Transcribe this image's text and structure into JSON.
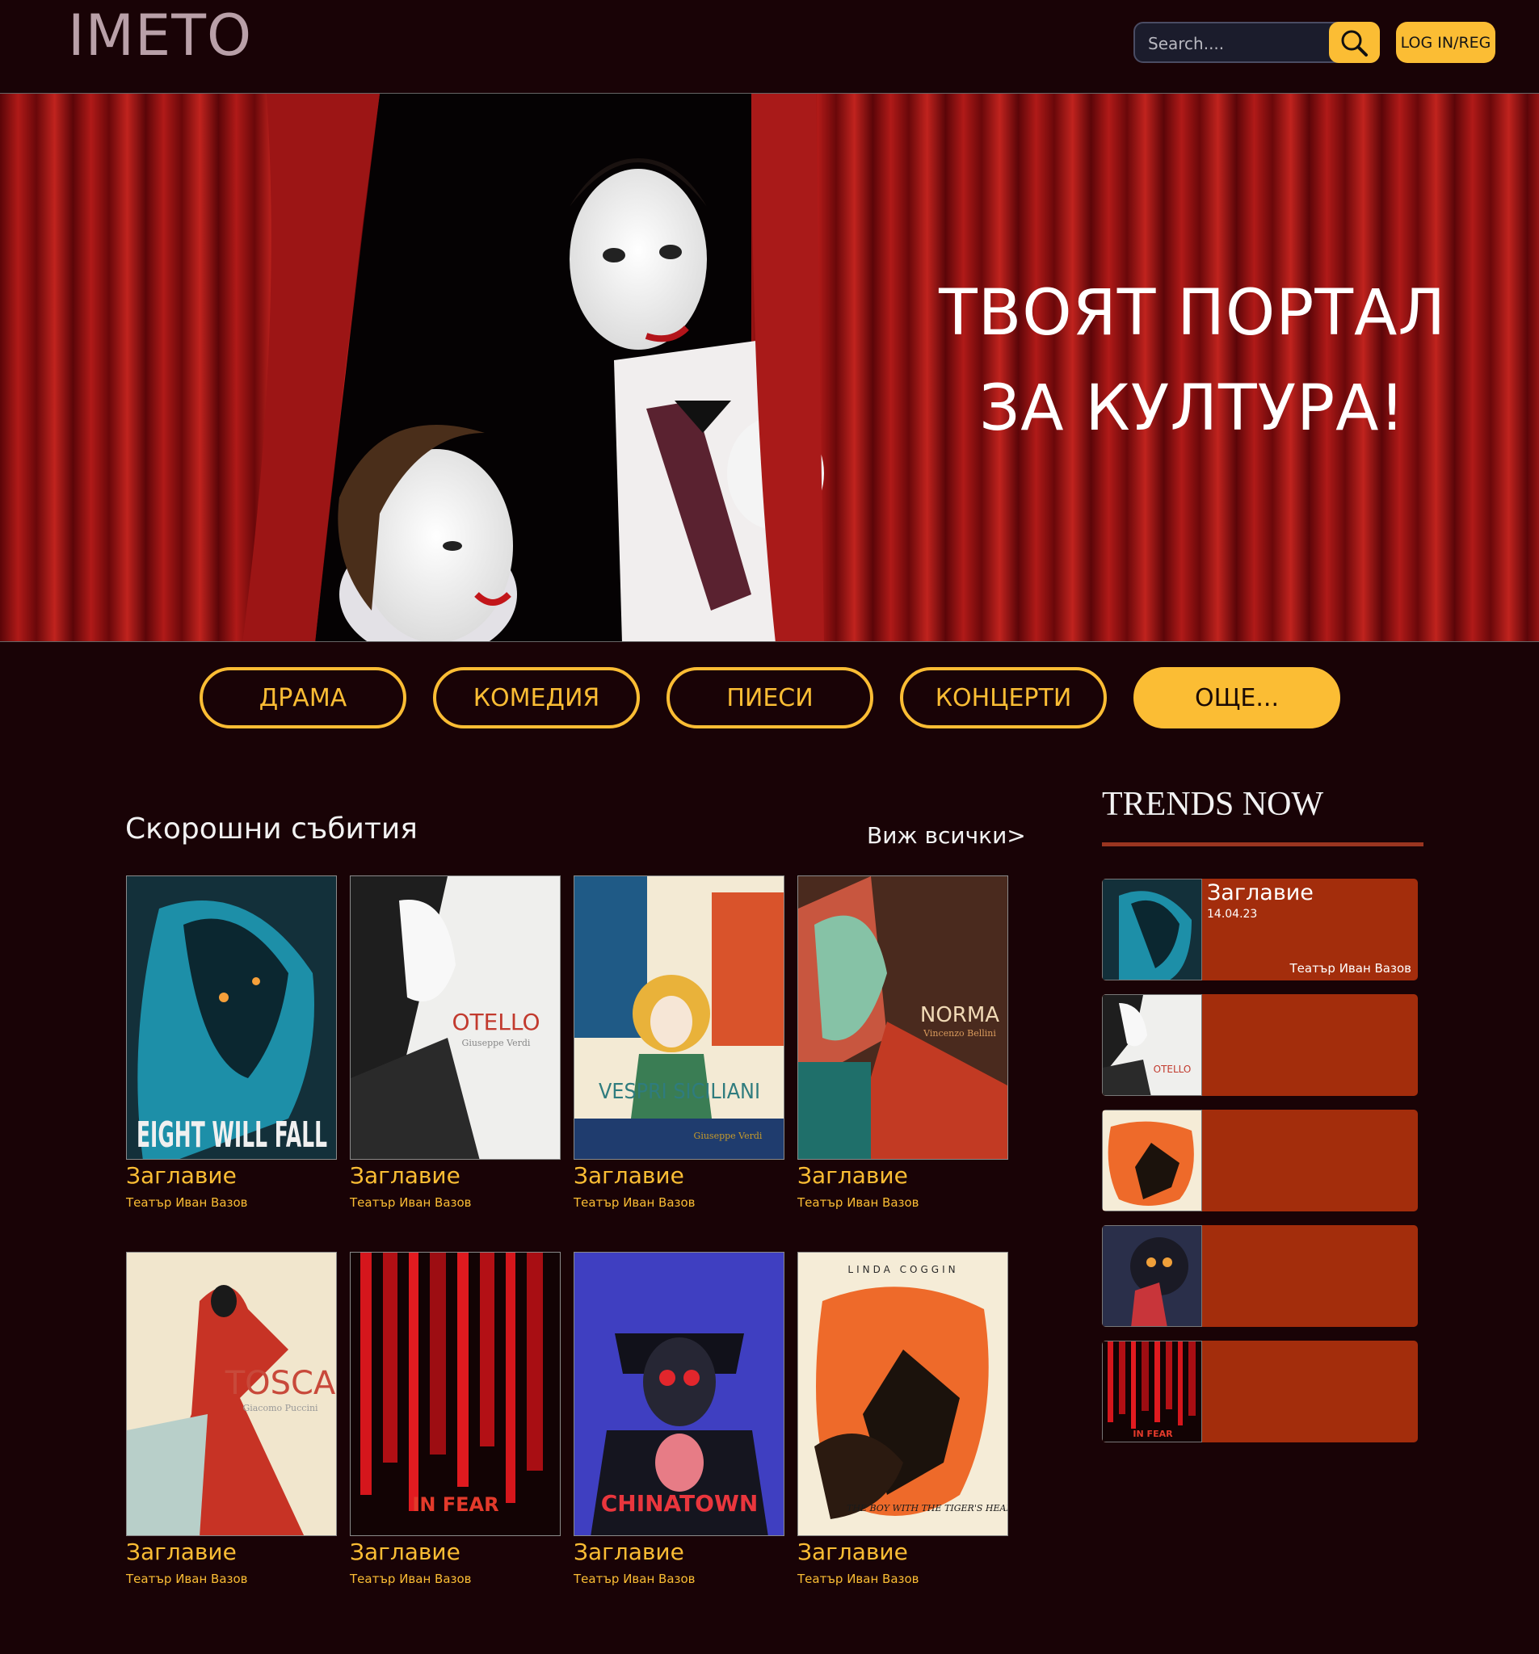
{
  "header": {
    "logo": "IMETO",
    "search_placeholder": "Search....",
    "login_label": "LOG IN/REG"
  },
  "hero": {
    "line1": "ТВОЯТ ПОРТАЛ",
    "line2": "ЗА КУЛТУРА!"
  },
  "categories": [
    "ДРАМА",
    "КОМЕДИЯ",
    "ПИЕСИ",
    "КОНЦЕРТИ",
    "ОЩЕ..."
  ],
  "recent": {
    "title": "Скорошни събития",
    "see_all": "Виж всички>",
    "items": [
      {
        "title": "Заглавие",
        "venue": "Театър Иван Вазов",
        "poster": "EIGHT WILL FALL"
      },
      {
        "title": "Заглавие",
        "venue": "Театър Иван Вазов",
        "poster": "OTELLO",
        "poster_sub": "Giuseppe Verdi"
      },
      {
        "title": "Заглавие",
        "venue": "Театър Иван Вазов",
        "poster": "VESPRI SICILIANI",
        "poster_sub": "Giuseppe Verdi"
      },
      {
        "title": "Заглавие",
        "venue": "Театър Иван Вазов",
        "poster": "NORMA",
        "poster_sub": "Vincenzo Bellini"
      },
      {
        "title": "Заглавие",
        "venue": "Театър Иван Вазов",
        "poster": "TOSCA",
        "poster_sub": "Giacomo Puccini"
      },
      {
        "title": "Заглавие",
        "venue": "Театър Иван Вазов",
        "poster": "IN FEAR"
      },
      {
        "title": "Заглавие",
        "venue": "Театър Иван Вазов",
        "poster": "CHINATOWN"
      },
      {
        "title": "Заглавие",
        "venue": "Театър Иван Вазов",
        "poster": "THE BOY WITH THE TIGER'S HEART",
        "poster_top": "LINDA COGGIN"
      }
    ]
  },
  "trends": {
    "title": "TRENDS NOW",
    "first": {
      "title": "Заглавие",
      "date": "14.04.23",
      "venue": "Театър Иван Вазов"
    }
  },
  "colors": {
    "accent": "#fbbd34",
    "background": "#190306",
    "card": "#a32d0c"
  }
}
